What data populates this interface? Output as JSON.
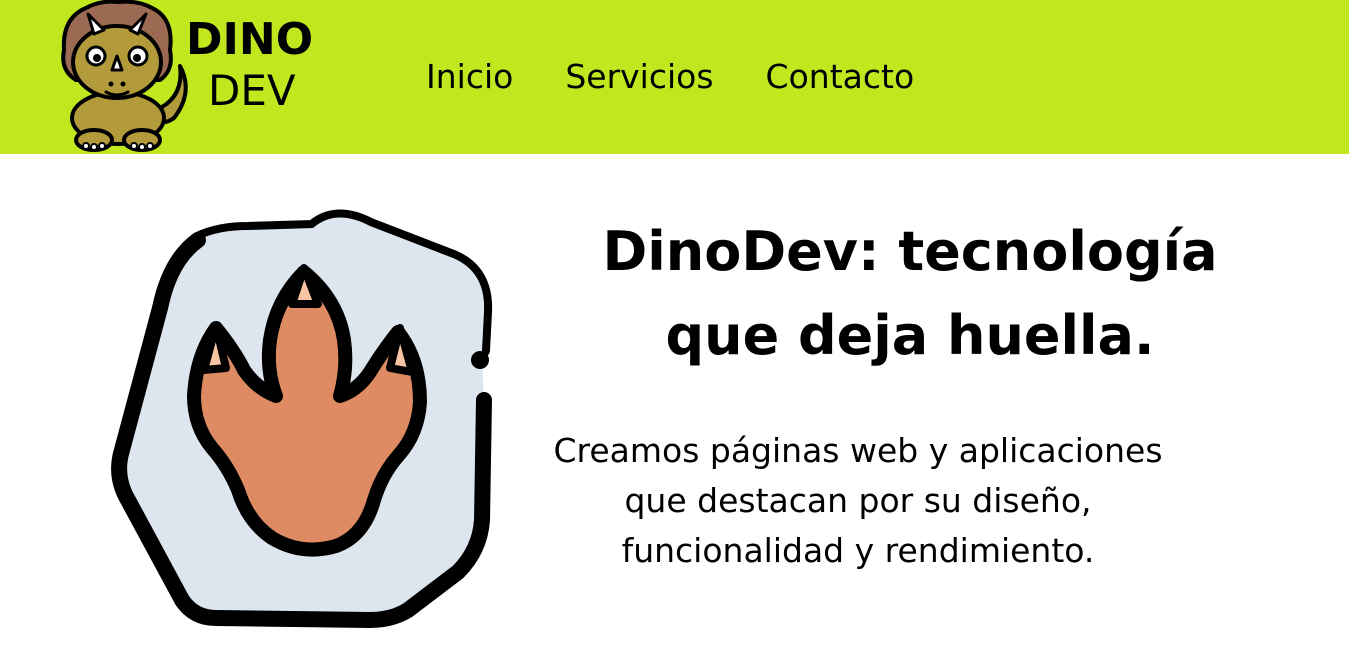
{
  "brand": {
    "logo_line1": "DINO",
    "logo_line2": "DEV",
    "logo_image": "triceratops-mascot"
  },
  "nav": {
    "items": [
      "Inicio",
      "Servicios",
      "Contacto"
    ]
  },
  "hero": {
    "title": "DinoDev: tecnología que deja huella.",
    "subtitle": "Creamos páginas web y aplicaciones que destacan por su diseño, funcionalidad y rendimiento.",
    "illustration": "dino-footprint-icon"
  },
  "colors": {
    "header_bg": "#c1e81e",
    "footprint": "#de8a63",
    "stone": "#dde6ee",
    "outline": "#000000"
  }
}
